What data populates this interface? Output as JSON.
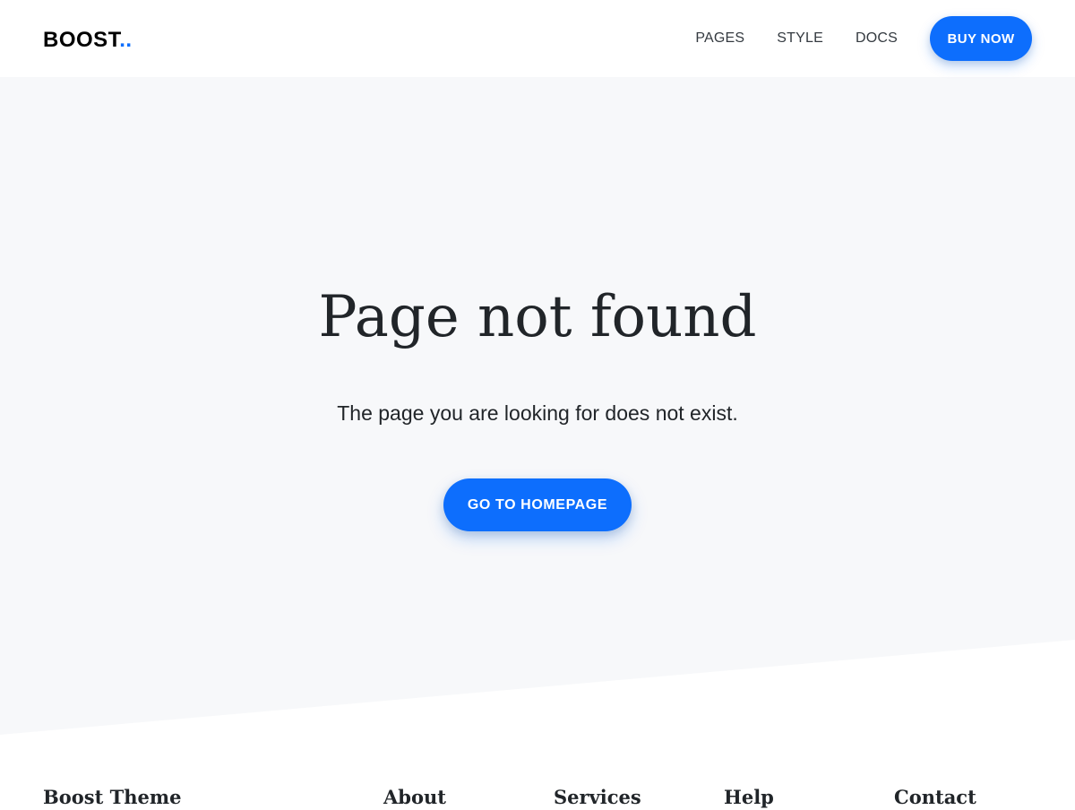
{
  "header": {
    "logo_text": "BOOST",
    "logo_dots": "..",
    "nav": [
      {
        "label": "PAGES"
      },
      {
        "label": "STYLE"
      },
      {
        "label": "DOCS"
      }
    ],
    "cta_label": "BUY NOW"
  },
  "hero": {
    "title": "Page not found",
    "subtitle": "The page you are looking for does not exist.",
    "button_label": "GO TO HOMEPAGE"
  },
  "footer": {
    "headings": [
      {
        "label": "Boost Theme"
      },
      {
        "label": "About"
      },
      {
        "label": "Services"
      },
      {
        "label": "Help"
      },
      {
        "label": "Contact"
      }
    ]
  },
  "colors": {
    "accent": "#0d6efd",
    "hero_background": "#f7f8fa",
    "text": "#212529"
  }
}
